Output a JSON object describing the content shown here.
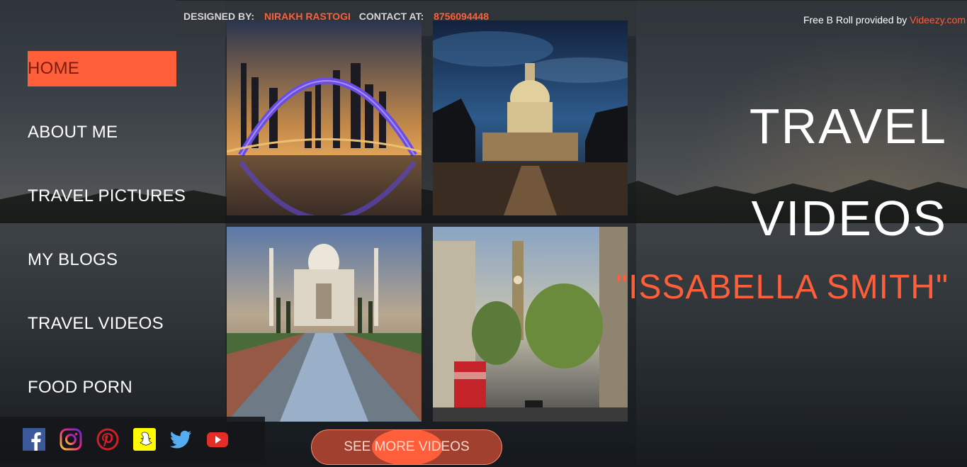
{
  "credits": {
    "designed_label": "DESIGNED BY:",
    "designer": "NIRAKH RASTOGI",
    "contact_label": "CONTACT AT:",
    "phone": "8756094448",
    "broll_text": "Free B Roll provided by ",
    "broll_link": "Videezy.com"
  },
  "nav": {
    "items": [
      {
        "label": "HOME",
        "active": true
      },
      {
        "label": "ABOUT ME"
      },
      {
        "label": "TRAVEL PICTURES"
      },
      {
        "label": "MY BLOGS"
      },
      {
        "label": "TRAVEL VIDEOS"
      },
      {
        "label": "FOOD PORN"
      }
    ]
  },
  "heading": {
    "line1": "TRAVEL",
    "line2": "VIDEOS",
    "author": "\"ISSABELLA SMITH\""
  },
  "gallery": {
    "photos": [
      "dubai-arch-bridge",
      "capitol-at-night",
      "taj-mahal",
      "london-big-ben"
    ]
  },
  "social": {
    "icons": [
      "facebook-icon",
      "instagram-icon",
      "pinterest-icon",
      "snapchat-icon",
      "twitter-icon",
      "youtube-icon"
    ]
  },
  "button": {
    "label": "SEE MORE VIDEOS"
  },
  "colors": {
    "accent": "#ff5e3a",
    "text": "#ffffff"
  }
}
